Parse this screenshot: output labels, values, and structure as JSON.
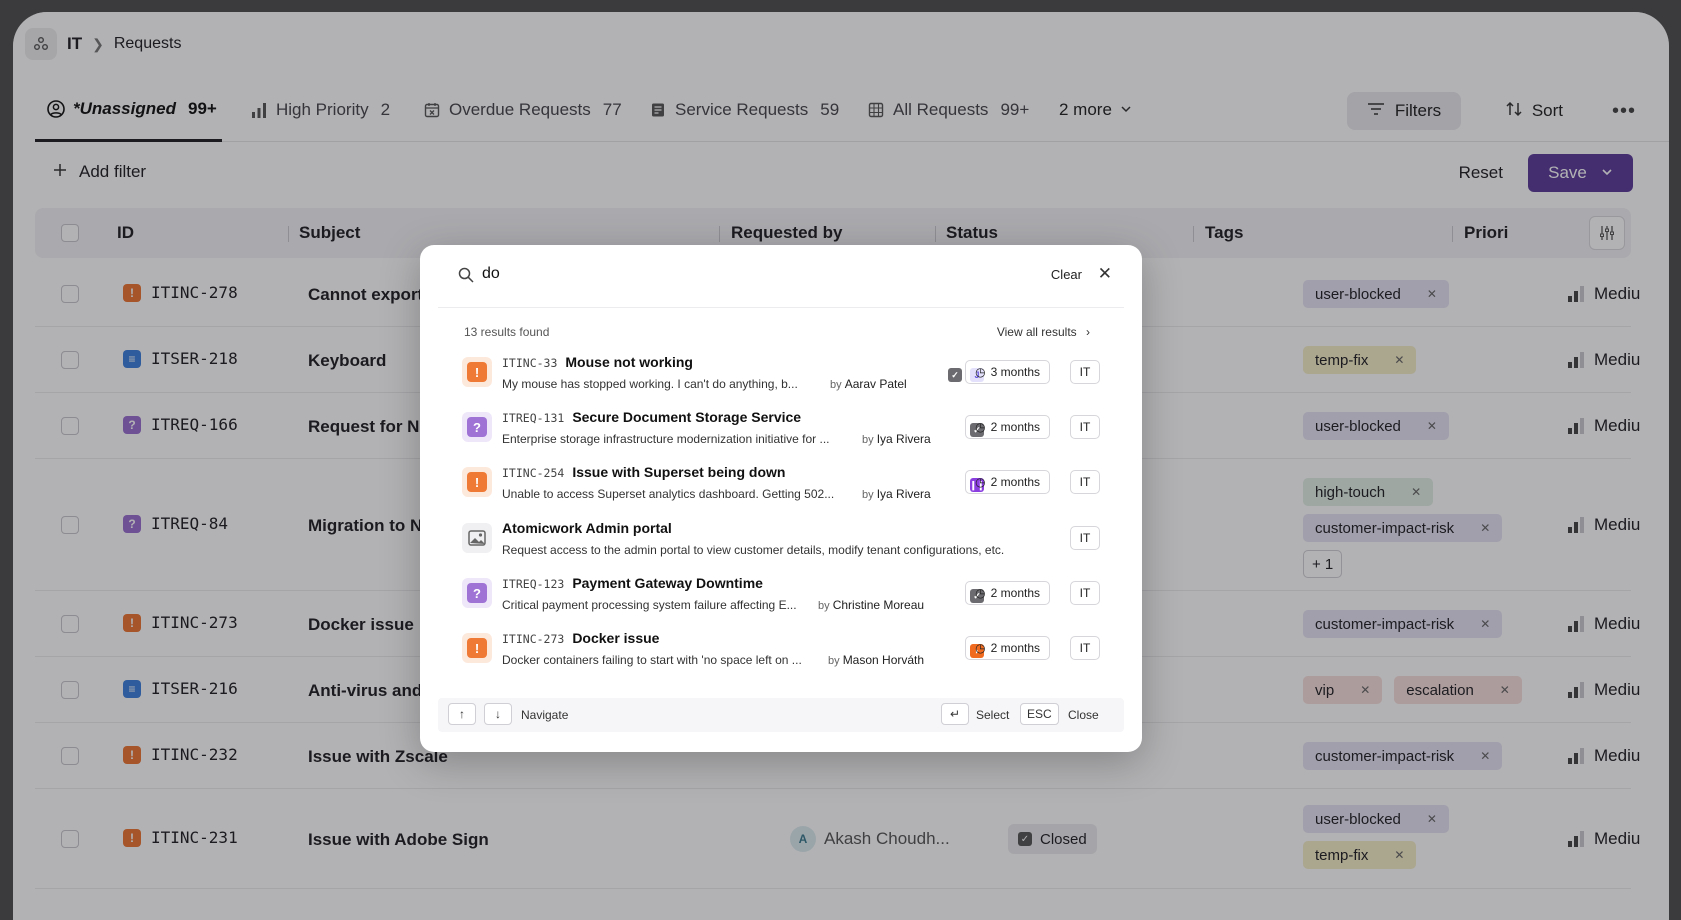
{
  "breadcrumb": {
    "root": "IT",
    "current": "Requests"
  },
  "tabs": [
    {
      "label": "*Unassigned",
      "count": "99+"
    },
    {
      "label": "High Priority",
      "count": "2"
    },
    {
      "label": "Overdue Requests",
      "count": "77"
    },
    {
      "label": "Service Requests",
      "count": "59"
    },
    {
      "label": "All Requests",
      "count": "99+"
    },
    {
      "label": "2 more",
      "count": ""
    }
  ],
  "toolbar": {
    "filters": "Filters",
    "sort": "Sort",
    "add_filter": "Add filter",
    "reset": "Reset",
    "save": "Save"
  },
  "table": {
    "headers": {
      "id": "ID",
      "subject": "Subject",
      "requested_by": "Requested by",
      "status": "Status",
      "tags": "Tags",
      "priority": "Priori"
    },
    "rows": [
      {
        "id": "ITINC-278",
        "type": "incident",
        "subject": "Cannot export Fig",
        "tags": [
          "user-blocked"
        ],
        "priority": "Mediu"
      },
      {
        "id": "ITSER-218",
        "type": "service",
        "subject": "Keyboard",
        "tags": [
          "temp-fix"
        ],
        "priority": "Mediu"
      },
      {
        "id": "ITREQ-166",
        "type": "request",
        "subject": "Request for New",
        "tags": [
          "user-blocked"
        ],
        "priority": "Mediu"
      },
      {
        "id": "ITREQ-84",
        "type": "request",
        "subject": "Migration to New",
        "tags": [
          "high-touch",
          "customer-impact-risk",
          "+ 1"
        ],
        "priority": "Mediu"
      },
      {
        "id": "ITINC-273",
        "type": "incident",
        "subject": "Docker issue",
        "tags": [
          "customer-impact-risk"
        ],
        "priority": "Mediu"
      },
      {
        "id": "ITSER-216",
        "type": "service",
        "subject": "Anti-virus and ar",
        "tags": [
          "vip",
          "escalation"
        ],
        "priority": "Mediu"
      },
      {
        "id": "ITINC-232",
        "type": "incident",
        "subject": "Issue with Zscale",
        "tags": [
          "customer-impact-risk"
        ],
        "priority": "Mediu"
      },
      {
        "id": "ITINC-231",
        "type": "incident",
        "subject": "Issue with Adobe Sign",
        "requested_by": "Akash Choudh...",
        "avatar": "A",
        "status": "Closed",
        "tags": [
          "user-blocked",
          "temp-fix"
        ],
        "priority": "Mediu"
      }
    ]
  },
  "search": {
    "query": "do",
    "clear": "Clear",
    "results_count": "13 results found",
    "view_all": "View all results",
    "results": [
      {
        "id": "ITINC-33",
        "title": "Mouse not working",
        "desc": "My mouse has stopped working. I can't do anything, b...",
        "by": "Aarav Patel",
        "age": "3 months",
        "team": "IT",
        "mark": "J"
      },
      {
        "id": "ITREQ-131",
        "title": "Secure Document Storage Service",
        "desc": "Enterprise storage infrastructure modernization initiative for ...",
        "by": "Iya Rivera",
        "age": "2 months",
        "team": "IT"
      },
      {
        "id": "ITINC-254",
        "title": "Issue with Superset being down",
        "desc": "Unable to access Superset analytics dashboard. Getting 502...",
        "by": "Iya Rivera",
        "age": "2 months",
        "team": "IT"
      },
      {
        "id": "",
        "title": "Atomicwork Admin portal",
        "desc": "Request access to the admin portal to view customer details, modify tenant configurations, etc.",
        "by": "",
        "age": "",
        "team": "IT"
      },
      {
        "id": "ITREQ-123",
        "title": "Payment Gateway Downtime",
        "desc": "Critical payment processing system failure affecting E...",
        "by": "Christine Moreau",
        "age": "2 months",
        "team": "IT"
      },
      {
        "id": "ITINC-273",
        "title": "Docker issue",
        "desc": "Docker containers failing to start with 'no space left on ...",
        "by": "Mason Horváth",
        "age": "2 months",
        "team": "IT"
      }
    ],
    "footer": {
      "navigate": "Navigate",
      "select": "Select",
      "esc_key": "ESC",
      "close": "Close"
    }
  }
}
